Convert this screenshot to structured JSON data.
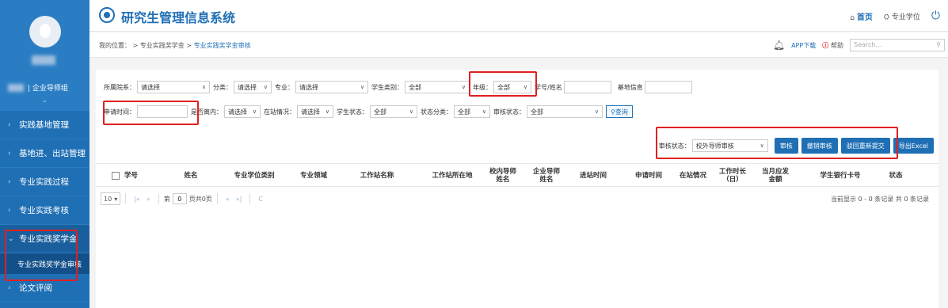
{
  "header": {
    "title": "研究生管理信息系统",
    "home": "首页",
    "degree": "专业学位"
  },
  "breadcrumb": {
    "prefix": "我的位置：",
    "path": "> 专业实践奖学金 >",
    "current": "专业实践奖学金审核"
  },
  "toolbar": {
    "app_download": "APP下载",
    "help": "帮助",
    "search_placeholder": "Search..."
  },
  "sidebar": {
    "user_role": "| 企业导师组",
    "items": [
      {
        "label": "实践基地管理"
      },
      {
        "label": "基地进、出站管理"
      },
      {
        "label": "专业实践过程"
      },
      {
        "label": "专业实践考核"
      },
      {
        "label": "专业实践奖学金"
      },
      {
        "label": "论文评阅"
      }
    ],
    "subitem": "专业实践奖学金审核"
  },
  "filters": {
    "row1": [
      {
        "label": "所属院系：",
        "value": "请选择"
      },
      {
        "label": "分类：",
        "value": "请选择"
      },
      {
        "label": "专业：",
        "value": "请选择"
      },
      {
        "label": "学生类别：",
        "value": "全部"
      },
      {
        "label": "年级：",
        "value": "全部"
      }
    ],
    "student_label": "学号/姓名",
    "base_label": "基地信息",
    "row2": {
      "apply_time_label": "申请时间：",
      "selects": [
        {
          "label": "是否离内：",
          "value": "请选择"
        },
        {
          "label": "在站情况：",
          "value": "请选择"
        },
        {
          "label": "学生状态：",
          "value": "全部"
        },
        {
          "label": "状态分类：",
          "value": "全部"
        },
        {
          "label": "审核状态：",
          "value": "全部"
        }
      ],
      "query": "查询"
    }
  },
  "actions": {
    "review_status_label": "审核状态：",
    "review_status_value": "校外导师审核",
    "approve": "审核",
    "revoke": "撤销审核",
    "reject": "驳回重新提交",
    "export": "导出Excel"
  },
  "table": {
    "columns": [
      "学号",
      "姓名",
      "专业学位类别",
      "专业领域",
      "工作站名称",
      "工作站所在地",
      "校内导师姓名",
      "企业导师姓名",
      "进站时间",
      "申请时间",
      "在站情况",
      "工作时长（日）",
      "当月应发金额",
      "学生银行卡号",
      "状态"
    ]
  },
  "pager": {
    "page_size": "10",
    "page_label": "第",
    "page_value": "0",
    "total_pages": "页共0页",
    "info": "当前显示 0 - 0 条记录 共 0 条记录"
  },
  "colors": {
    "sidebar": "#1f6fb5",
    "accent": "#1f6fb5",
    "highlight": "#e02020"
  }
}
